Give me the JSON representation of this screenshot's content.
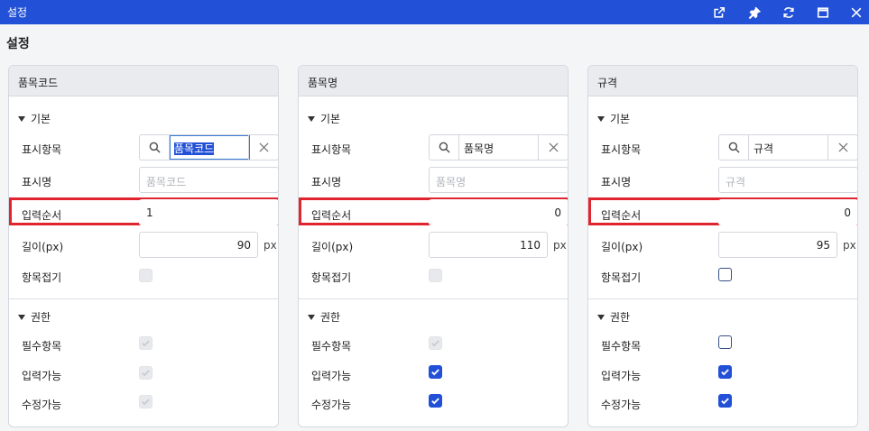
{
  "window": {
    "title": "설정"
  },
  "page": {
    "title": "설정"
  },
  "section_labels": {
    "basic": "기본",
    "permissions": "권한"
  },
  "field_labels": {
    "display_item": "표시항목",
    "display_name": "표시명",
    "input_order": "입력순서",
    "length": "길이(px)",
    "fold": "항목접기",
    "required": "필수항목",
    "input_enabled": "입력가능",
    "edit_enabled": "수정가능"
  },
  "unit": "px",
  "panels": [
    {
      "header": "품목코드",
      "display_item": "품목코드",
      "display_name_placeholder": "품목코드",
      "input_order": "1",
      "length": "90",
      "fold": "disabled",
      "required": "disabled-checked",
      "input_enabled": "disabled-checked",
      "edit_enabled": "disabled-checked"
    },
    {
      "header": "품목명",
      "display_item": "품목명",
      "display_name_placeholder": "품목명",
      "input_order": "0",
      "length": "110",
      "fold": "disabled",
      "required": "disabled-checked",
      "input_enabled": "checked",
      "edit_enabled": "checked"
    },
    {
      "header": "규격",
      "display_item": "규격",
      "display_name_placeholder": "규격",
      "input_order": "0",
      "length": "95",
      "fold": "unchecked",
      "required": "unchecked",
      "input_enabled": "checked",
      "edit_enabled": "checked"
    }
  ],
  "colors": {
    "titlebar": "#2250d6",
    "highlight": "#e0252f",
    "checkbox": "#2250d6"
  },
  "icons": [
    "external-link-icon",
    "pin-icon",
    "refresh-icon",
    "maximize-icon",
    "close-icon",
    "search-icon",
    "clear-icon",
    "check-icon",
    "caret-down-icon"
  ]
}
